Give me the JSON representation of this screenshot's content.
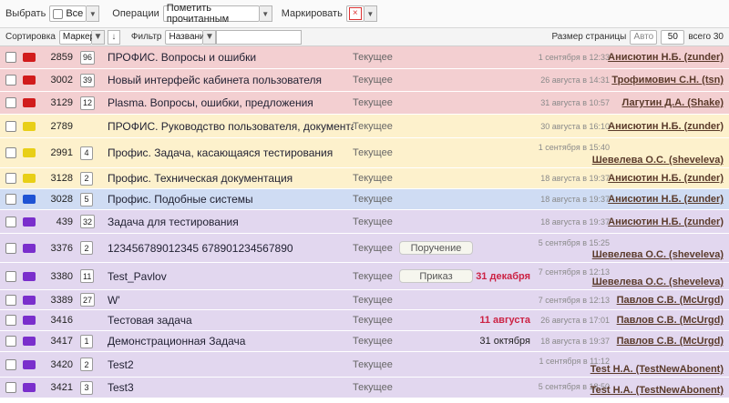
{
  "toolbar": {
    "select_label": "Выбрать",
    "select_value": "Все",
    "ops_label": "Операции",
    "ops_value": "Пометить прочитанным",
    "mark_label": "Маркировать",
    "mark_value": "×"
  },
  "toolbar2": {
    "sort_label": "Сортировка",
    "sort_value": "Маркеры",
    "sort_dir": "↓",
    "filter_label": "Фильтр",
    "filter_value": "Название",
    "filter_input": "",
    "page_size_label": "Размер страницы",
    "page_auto": "Авто",
    "page_size": "50",
    "total": "всего 30"
  },
  "colors": {
    "red_row": "#f3cfd1",
    "yellow_row": "#fdf1cc",
    "blue_row": "#cfdcf3",
    "purple_row": "#e2d7ef",
    "red_marker": "#d11c1c",
    "yellow_marker": "#e8cf17",
    "blue_marker": "#1f53d4",
    "purple_marker": "#7a2fcc"
  },
  "rows": [
    {
      "color": "red",
      "id": "2859",
      "count": "96",
      "title": "ПРОФИС. Вопросы и ошибки",
      "status": "Текущее",
      "kind": "",
      "deadline": "",
      "deadline_style": "",
      "date": "1 сентября в 12:33",
      "author": "Анисютин Н.Б. (zunder)"
    },
    {
      "color": "red",
      "id": "3002",
      "count": "39",
      "title": "Новый интерфейс кабинета пользователя",
      "status": "Текущее",
      "kind": "",
      "deadline": "",
      "deadline_style": "",
      "date": "26 августа в 14:31",
      "author": "Трофимович С.Н. (tsn)"
    },
    {
      "color": "red",
      "id": "3129",
      "count": "12",
      "title": "Plasma. Вопросы, ошибки, предложения",
      "status": "Текущее",
      "kind": "",
      "deadline": "",
      "deadline_style": "",
      "date": "31 августа в 10:57",
      "author": "Лагутин Д.А. (Shake)"
    },
    {
      "color": "yellow",
      "id": "2789",
      "count": "",
      "title": "ПРОФИС. Руководство пользователя, документация",
      "status": "Текущее",
      "kind": "",
      "deadline": "",
      "deadline_style": "",
      "date": "30 августа в 16:10",
      "author": "Анисютин Н.Б. (zunder)"
    },
    {
      "color": "yellow",
      "id": "2991",
      "count": "4",
      "title": "Профис. Задача, касающаяся тестирования",
      "status": "Текущее",
      "kind": "",
      "deadline": "",
      "deadline_style": "",
      "date": "1 сентября в 15:40",
      "author": "Шевелева О.С. (sheveleva)",
      "tall": true
    },
    {
      "color": "yellow",
      "id": "3128",
      "count": "2",
      "title": "Профис. Техническая документация",
      "status": "Текущее",
      "kind": "",
      "deadline": "",
      "deadline_style": "",
      "date": "18 августа в 19:37",
      "author": "Анисютин Н.Б. (zunder)"
    },
    {
      "color": "blue",
      "id": "3028",
      "count": "5",
      "title": "Профис. Подобные системы",
      "status": "Текущее",
      "kind": "",
      "deadline": "",
      "deadline_style": "",
      "date": "18 августа в 19:37",
      "author": "Анисютин Н.Б. (zunder)"
    },
    {
      "color": "purple",
      "id": "439",
      "count": "32",
      "title": "Задача для тестирования",
      "status": "Текущее",
      "kind": "",
      "deadline": "",
      "deadline_style": "",
      "date": "18 августа в 19:37",
      "author": "Анисютин Н.Б. (zunder)"
    },
    {
      "color": "purple",
      "id": "3376",
      "count": "2",
      "title": "123456789012345 678901234567890",
      "status": "Текущее",
      "kind": "Поручение",
      "deadline": "",
      "deadline_style": "",
      "date": "5 сентября в 15:25",
      "author": "Шевелева О.С. (sheveleva)",
      "tall": true
    },
    {
      "color": "purple",
      "id": "3380",
      "count": "11",
      "title": "Test_Pavlov",
      "status": "Текущее",
      "kind": "Приказ",
      "deadline": "31 декабря",
      "deadline_style": "red",
      "date": "7 сентября в 12:13",
      "author": "Шевелева О.С. (sheveleva)",
      "tall": true
    },
    {
      "color": "purple",
      "id": "3389",
      "count": "27",
      "title": "W'",
      "status": "Текущее",
      "kind": "",
      "deadline": "",
      "deadline_style": "",
      "date": "7 сентября в 12:13",
      "author": "Павлов С.В. (McUrgd)"
    },
    {
      "color": "purple",
      "id": "3416",
      "count": "",
      "title": "Тестовая задача",
      "status": "Текущее",
      "kind": "",
      "deadline": "11 августа",
      "deadline_style": "red",
      "date": "26 августа в 17:01",
      "author": "Павлов С.В. (McUrgd)"
    },
    {
      "color": "purple",
      "id": "3417",
      "count": "1",
      "title": "Демонстрационная Задача",
      "status": "Текущее",
      "kind": "",
      "deadline": "31 октября",
      "deadline_style": "plain",
      "date": "18 августа в 19:37",
      "author": "Павлов С.В. (McUrgd)"
    },
    {
      "color": "purple",
      "id": "3420",
      "count": "2",
      "title": "Test2",
      "status": "Текущее",
      "kind": "",
      "deadline": "",
      "deadline_style": "",
      "date": "1 сентября в 11:12",
      "author": "Test Н.А. (TestNewAbonent)",
      "tall": true
    },
    {
      "color": "purple",
      "id": "3421",
      "count": "3",
      "title": "Test3",
      "status": "Текущее",
      "kind": "",
      "deadline": "",
      "deadline_style": "",
      "date": "5 сентября в 18:50",
      "author": "Test Н.А. (TestNewAbonent)",
      "tall": true
    }
  ]
}
